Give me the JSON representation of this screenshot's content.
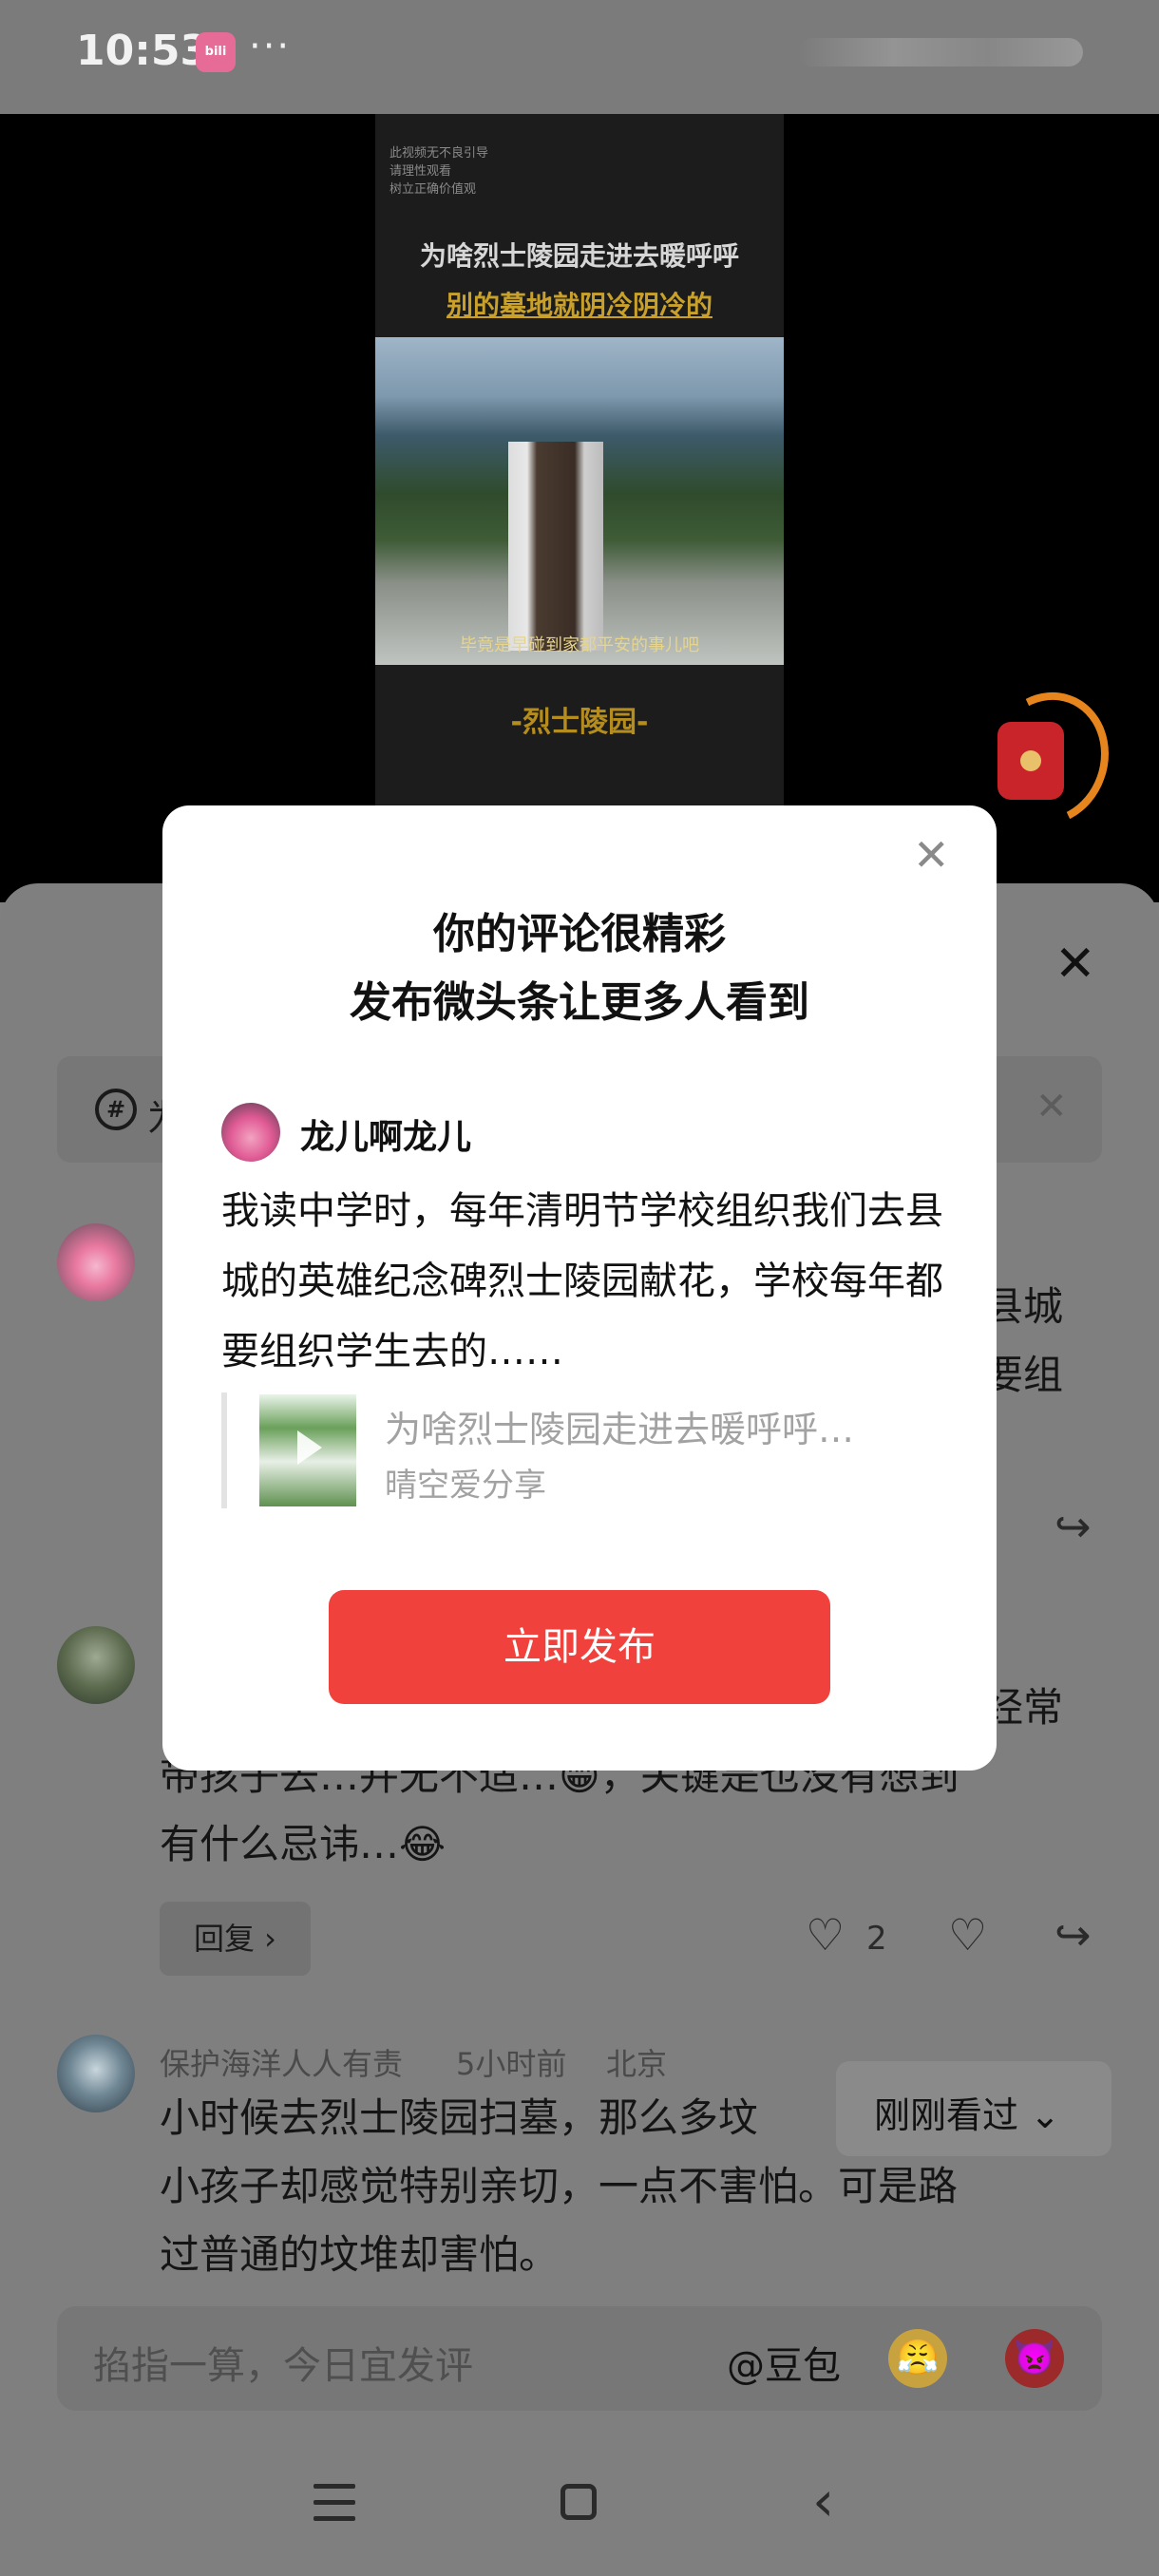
{
  "status_bar": {
    "time": "10:53",
    "app_badge": "bilibili",
    "more": "···"
  },
  "video": {
    "disclaimer": [
      "此视频无不良引导",
      "请理性观看",
      "树立正确价值观"
    ],
    "title_line1": "为啥烈士陵园走进去暖呼呼",
    "title_line2": "别的墓地就阴冷阴冷的",
    "subtitle": "毕竟是早碰到家都平安的事儿吧",
    "bottom_tag": "-烈士陵园-"
  },
  "sheet": {
    "close": "✕",
    "topic_prefix": "为",
    "topic_close": "✕",
    "comments": [
      {
        "name": "",
        "text_lines": [
          "县城",
          "要组"
        ],
        "likes": ""
      },
      {
        "name": "",
        "text_lines": [
          "经常",
          "带孩子去…并无不适…😁，关键是也没有想到",
          "有什么忌讳…😂"
        ],
        "reply": "回复 ›",
        "likes": "2"
      },
      {
        "name": "保护海洋人人有责",
        "time": "5小时前",
        "location": "北京",
        "text_lines": [
          "小时候去烈士陵园扫墓，那么多坟",
          "小孩子却感觉特别亲切，一点不害怕。可是路",
          "过普通的坟堆却害怕。"
        ]
      }
    ],
    "just_seen": "刚刚看过 ⌄"
  },
  "input": {
    "placeholder": "掐指一算，今日宜发评",
    "at_doubao": "@豆包",
    "emoji1": "😤",
    "emoji2": "👿"
  },
  "popup": {
    "close": "✕",
    "title_line1": "你的评论很精彩",
    "title_line2": "发布微头条让更多人看到",
    "author": "龙儿啊龙儿",
    "comment": "我读中学时，每年清明节学校组织我们去县城的英雄纪念碑烈士陵园献花，学校每年都要组织学生去的……",
    "quote_title": "为啥烈士陵园走进去暖呼呼…",
    "quote_author": "晴空爱分享",
    "publish_label": "立即发布"
  },
  "colors": {
    "accent": "#f0413c",
    "dim_overlay": "#7f7f7f",
    "gold": "#c9a12a"
  }
}
